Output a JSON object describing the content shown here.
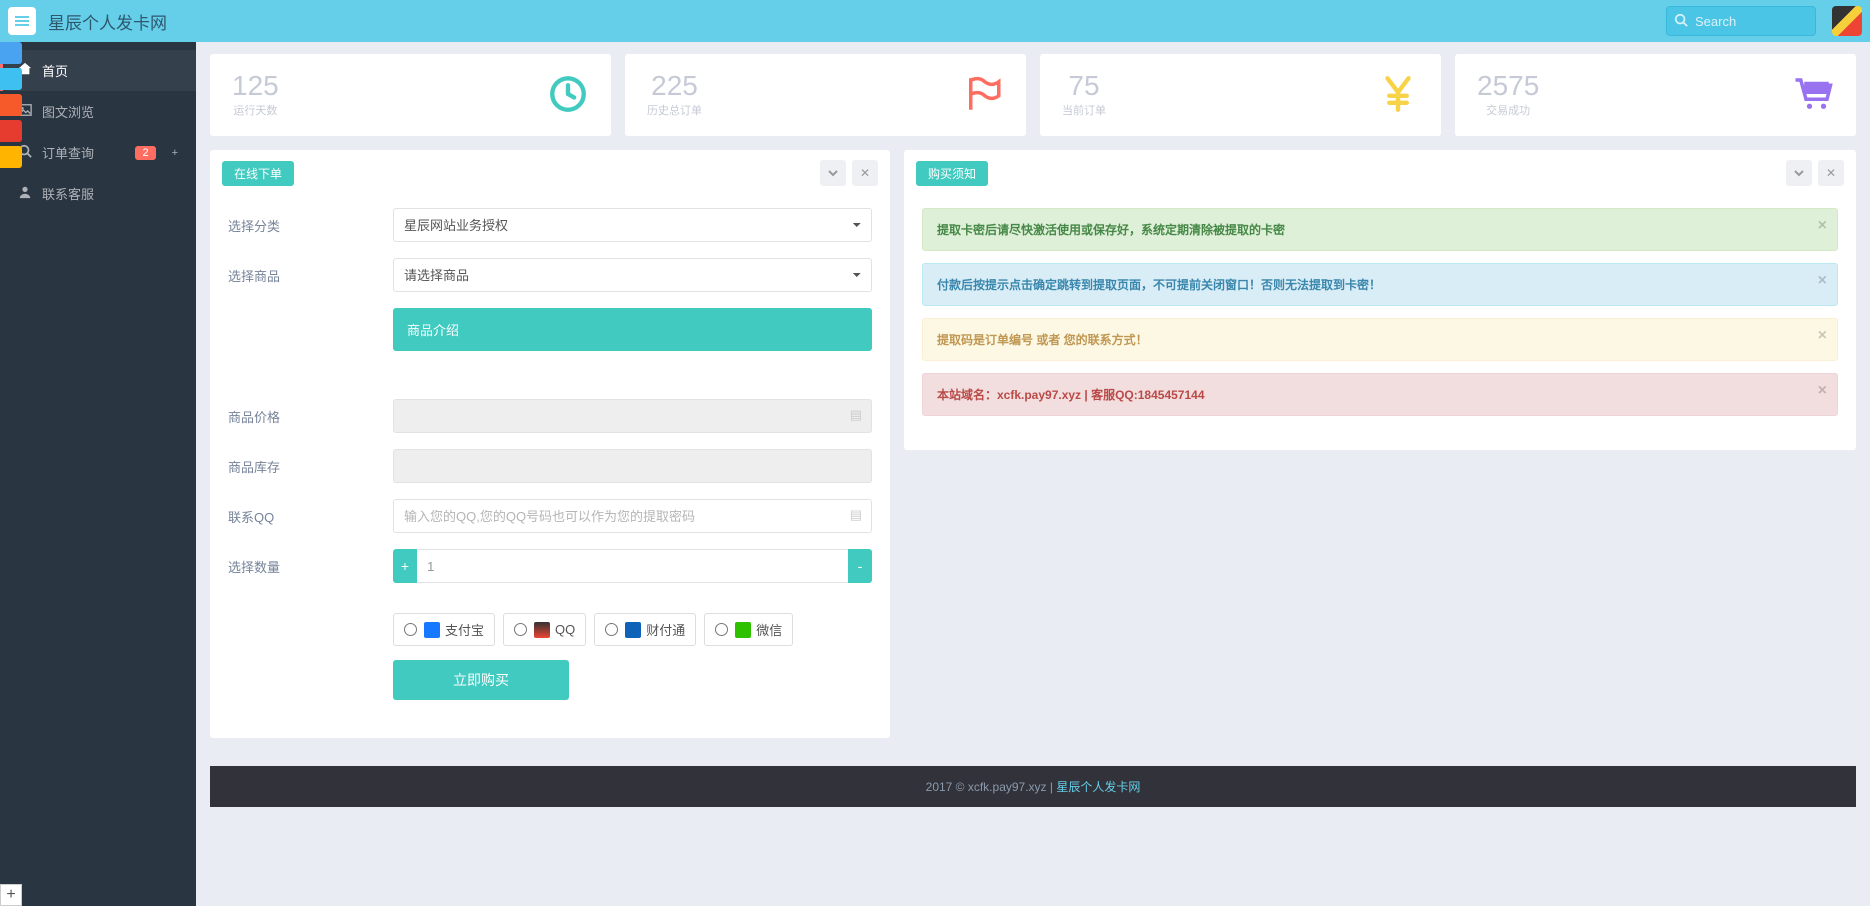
{
  "header": {
    "brand": "星辰个人发卡网",
    "search_placeholder": "Search"
  },
  "sidebar": {
    "items": [
      {
        "label": "首页"
      },
      {
        "label": "图文浏览"
      },
      {
        "label": "订单查询",
        "badge": "2"
      },
      {
        "label": "联系客服"
      }
    ]
  },
  "stats": [
    {
      "num": "125",
      "label": "运行天数",
      "color": "#41cac0"
    },
    {
      "num": "225",
      "label": "历史总订单",
      "color": "#ff6c60"
    },
    {
      "num": "75",
      "label": "当前订单",
      "color": "#f8d347"
    },
    {
      "num": "2575",
      "label": "交易成功",
      "color": "#9972ef"
    }
  ],
  "order_panel": {
    "title": "在线下单",
    "category_label": "选择分类",
    "category_value": "星辰网站业务授权",
    "product_label": "选择商品",
    "product_value": "请选择商品",
    "intro_label": "商品介绍",
    "price_label": "商品价格",
    "stock_label": "商品库存",
    "qq_label": "联系QQ",
    "qq_placeholder": "输入您的QQ,您的QQ号码也可以作为您的提取密码",
    "qty_label": "选择数量",
    "qty_value": "1",
    "pay_alipay": "支付宝",
    "pay_qq": "QQ",
    "pay_tenpay": "财付通",
    "pay_wechat": "微信",
    "buy_btn": "立即购买"
  },
  "notice_panel": {
    "title": "购买须知",
    "alerts": [
      {
        "type": "success",
        "text": "提取卡密后请尽快激活使用或保存好，系统定期清除被提取的卡密"
      },
      {
        "type": "info",
        "text": "付款后按提示点击确定跳转到提取页面，不可提前关闭窗口！否则无法提取到卡密！"
      },
      {
        "type": "warning",
        "text": "提取码是订单编号 或者 您的联系方式！"
      },
      {
        "type": "danger",
        "text": "本站域名：xcfk.pay97.xyz | 客服QQ:1845457144"
      }
    ]
  },
  "footer": {
    "copy": "2017 © xcfk.pay97.xyz | ",
    "link": "星辰个人发卡网"
  }
}
